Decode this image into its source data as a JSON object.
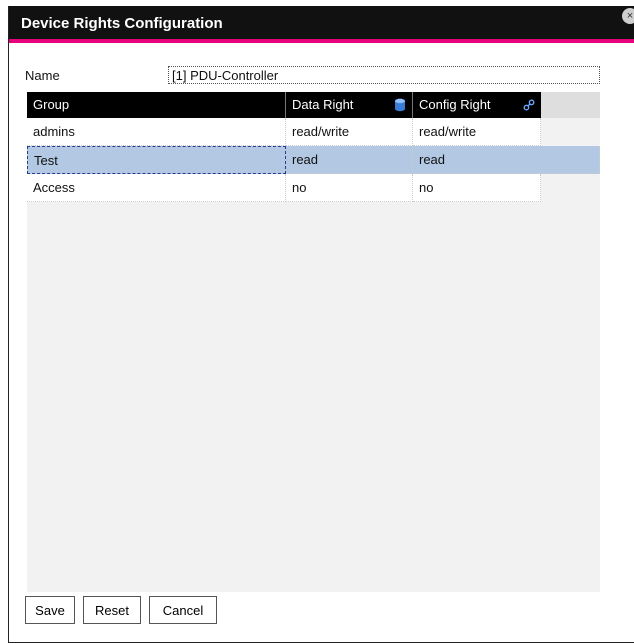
{
  "dialog": {
    "title": "Device Rights Configuration",
    "close_glyph": "×",
    "accent_color": "#e6007e"
  },
  "name_field": {
    "label": "Name",
    "value": "[1] PDU-Controller"
  },
  "table": {
    "columns": [
      {
        "label": "Group",
        "icon": null
      },
      {
        "label": "Data Right",
        "icon": "database-icon"
      },
      {
        "label": "Config Right",
        "icon": "link-icon"
      }
    ],
    "rows": [
      {
        "group": "admins",
        "data_right": "read/write",
        "config_right": "read/write",
        "selected": false
      },
      {
        "group": "Test",
        "data_right": "read",
        "config_right": "read",
        "selected": true
      },
      {
        "group": "Access",
        "data_right": "no",
        "config_right": "no",
        "selected": false
      }
    ],
    "selection_color": "#b3c9e3"
  },
  "buttons": {
    "save": "Save",
    "reset": "Reset",
    "cancel": "Cancel"
  }
}
